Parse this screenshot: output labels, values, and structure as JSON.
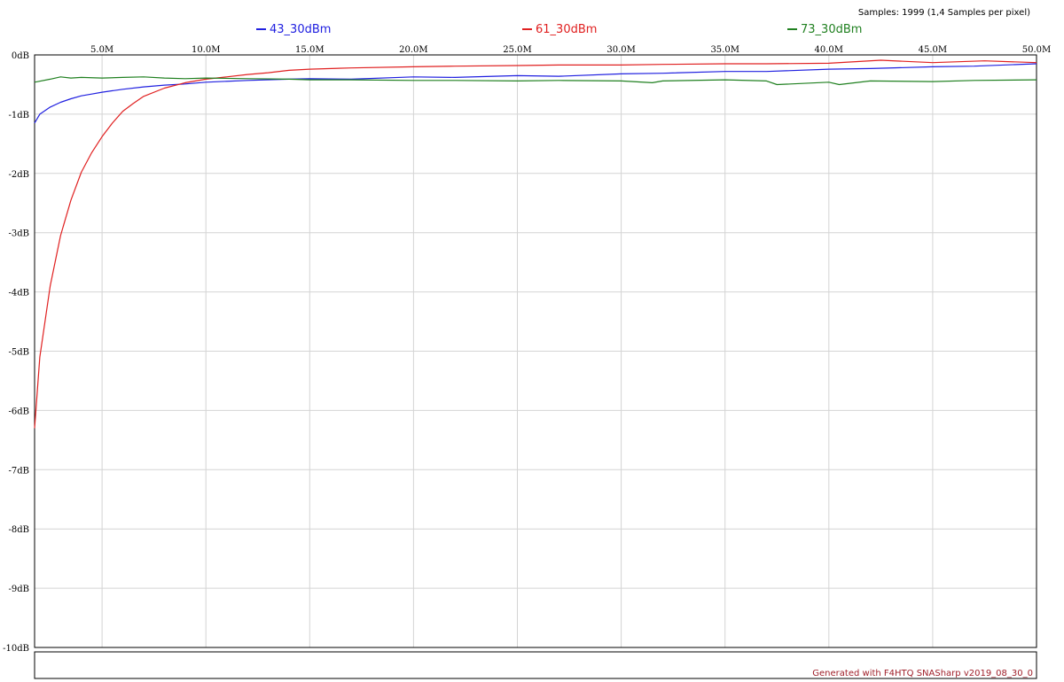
{
  "header": {
    "samples_text": "Samples: 1999 (1,4 Samples per pixel)"
  },
  "footer": {
    "generated_text": "Generated with F4HTQ SNASharp v2019_08_30_0"
  },
  "chart_data": {
    "type": "line",
    "title": "",
    "xlabel": "",
    "ylabel": "",
    "xlim": [
      1.75,
      50.0
    ],
    "ylim": [
      -10,
      0
    ],
    "grid": true,
    "legend_position": "top",
    "x_ticks": [
      {
        "value": 5.0,
        "label": "5.0M"
      },
      {
        "value": 10.0,
        "label": "10.0M"
      },
      {
        "value": 15.0,
        "label": "15.0M"
      },
      {
        "value": 20.0,
        "label": "20.0M"
      },
      {
        "value": 25.0,
        "label": "25.0M"
      },
      {
        "value": 30.0,
        "label": "30.0M"
      },
      {
        "value": 35.0,
        "label": "35.0M"
      },
      {
        "value": 40.0,
        "label": "40.0M"
      },
      {
        "value": 45.0,
        "label": "45.0M"
      },
      {
        "value": 50.0,
        "label": "50.0M"
      }
    ],
    "y_ticks": [
      {
        "value": 0,
        "label": "0dB"
      },
      {
        "value": -1,
        "label": "-1dB"
      },
      {
        "value": -2,
        "label": "-2dB"
      },
      {
        "value": -3,
        "label": "-3dB"
      },
      {
        "value": -4,
        "label": "-4dB"
      },
      {
        "value": -5,
        "label": "-5dB"
      },
      {
        "value": -6,
        "label": "-6dB"
      },
      {
        "value": -7,
        "label": "-7dB"
      },
      {
        "value": -8,
        "label": "-8dB"
      },
      {
        "value": -9,
        "label": "-9dB"
      },
      {
        "value": -10,
        "label": "-10dB"
      }
    ],
    "series": [
      {
        "name": "43_30dBm",
        "color": "#2020e0",
        "x": [
          1.75,
          2.0,
          2.5,
          3.0,
          3.5,
          4.0,
          4.5,
          5.0,
          6.0,
          7.0,
          8.0,
          9.0,
          10.0,
          12.0,
          14.0,
          15.0,
          17.0,
          20.0,
          22.0,
          25.0,
          27.0,
          30.0,
          32.0,
          35.0,
          37.0,
          40.0,
          42.0,
          45.0,
          47.0,
          50.0
        ],
        "y": [
          -1.15,
          -1.0,
          -0.88,
          -0.8,
          -0.74,
          -0.69,
          -0.66,
          -0.63,
          -0.58,
          -0.54,
          -0.51,
          -0.49,
          -0.46,
          -0.43,
          -0.41,
          -0.4,
          -0.41,
          -0.37,
          -0.38,
          -0.35,
          -0.36,
          -0.32,
          -0.31,
          -0.28,
          -0.28,
          -0.24,
          -0.23,
          -0.2,
          -0.19,
          -0.15
        ]
      },
      {
        "name": "61_30dBm",
        "color": "#e02020",
        "x": [
          1.75,
          2.0,
          2.5,
          3.0,
          3.5,
          4.0,
          4.5,
          5.0,
          5.5,
          6.0,
          6.5,
          7.0,
          8.0,
          9.0,
          10.0,
          11.0,
          12.0,
          13.0,
          14.0,
          15.0,
          17.0,
          20.0,
          22.0,
          25.0,
          27.0,
          30.0,
          32.0,
          35.0,
          37.0,
          40.0,
          42.5,
          45.0,
          47.5,
          50.0
        ],
        "y": [
          -6.3,
          -5.1,
          -3.9,
          -3.05,
          -2.45,
          -1.98,
          -1.65,
          -1.38,
          -1.15,
          -0.95,
          -0.82,
          -0.7,
          -0.56,
          -0.47,
          -0.41,
          -0.37,
          -0.33,
          -0.3,
          -0.26,
          -0.24,
          -0.22,
          -0.2,
          -0.19,
          -0.18,
          -0.17,
          -0.17,
          -0.16,
          -0.15,
          -0.15,
          -0.14,
          -0.09,
          -0.13,
          -0.1,
          -0.13
        ]
      },
      {
        "name": "73_30dBm",
        "color": "#208020",
        "x": [
          1.75,
          2.5,
          3.0,
          3.5,
          4.0,
          5.0,
          6.0,
          7.0,
          8.0,
          9.0,
          10.0,
          12.0,
          14.0,
          15.0,
          17.0,
          20.0,
          22.0,
          25.0,
          27.0,
          30.0,
          31.5,
          32.0,
          35.0,
          37.0,
          37.5,
          40.0,
          40.5,
          42.0,
          45.0,
          47.0,
          50.0
        ],
        "y": [
          -0.46,
          -0.41,
          -0.37,
          -0.39,
          -0.38,
          -0.39,
          -0.38,
          -0.37,
          -0.39,
          -0.4,
          -0.39,
          -0.4,
          -0.41,
          -0.42,
          -0.42,
          -0.43,
          -0.43,
          -0.44,
          -0.43,
          -0.44,
          -0.47,
          -0.44,
          -0.42,
          -0.44,
          -0.5,
          -0.46,
          -0.5,
          -0.44,
          -0.45,
          -0.43,
          -0.42
        ]
      }
    ]
  }
}
